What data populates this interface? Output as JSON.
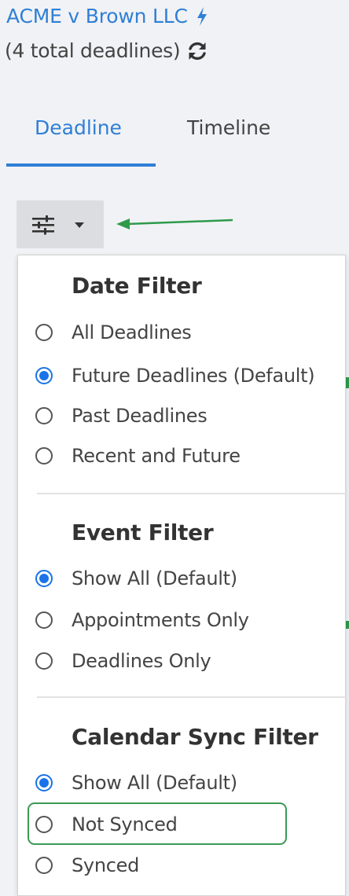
{
  "header": {
    "matter_title": "ACME v Brown LLC",
    "subtitle": "(4 total deadlines)",
    "title_icon": "lightning-bolt-icon",
    "refresh_icon": "sync-icon",
    "accent_color": "#2f7fd6"
  },
  "tabs": [
    {
      "label": "Deadline",
      "active": true
    },
    {
      "label": "Timeline",
      "active": false
    }
  ],
  "filter_button": {
    "icon": "sliders-icon",
    "caret_icon": "caret-down-icon"
  },
  "annotation": {
    "arrow_color": "#2e9a4c",
    "highlight_color": "#3a9a55"
  },
  "dropdown": {
    "sections": [
      {
        "heading": "Date Filter",
        "options": [
          {
            "label": "All Deadlines",
            "checked": false
          },
          {
            "label": "Future Deadlines (Default)",
            "checked": true
          },
          {
            "label": "Past Deadlines",
            "checked": false
          },
          {
            "label": "Recent and Future",
            "checked": false
          }
        ]
      },
      {
        "heading": "Event Filter",
        "options": [
          {
            "label": "Show All (Default)",
            "checked": true
          },
          {
            "label": "Appointments Only",
            "checked": false
          },
          {
            "label": "Deadlines Only",
            "checked": false
          }
        ]
      },
      {
        "heading": "Calendar Sync Filter",
        "options": [
          {
            "label": "Show All (Default)",
            "checked": true
          },
          {
            "label": "Not Synced",
            "checked": false
          },
          {
            "label": "Synced",
            "checked": false
          }
        ]
      }
    ]
  }
}
